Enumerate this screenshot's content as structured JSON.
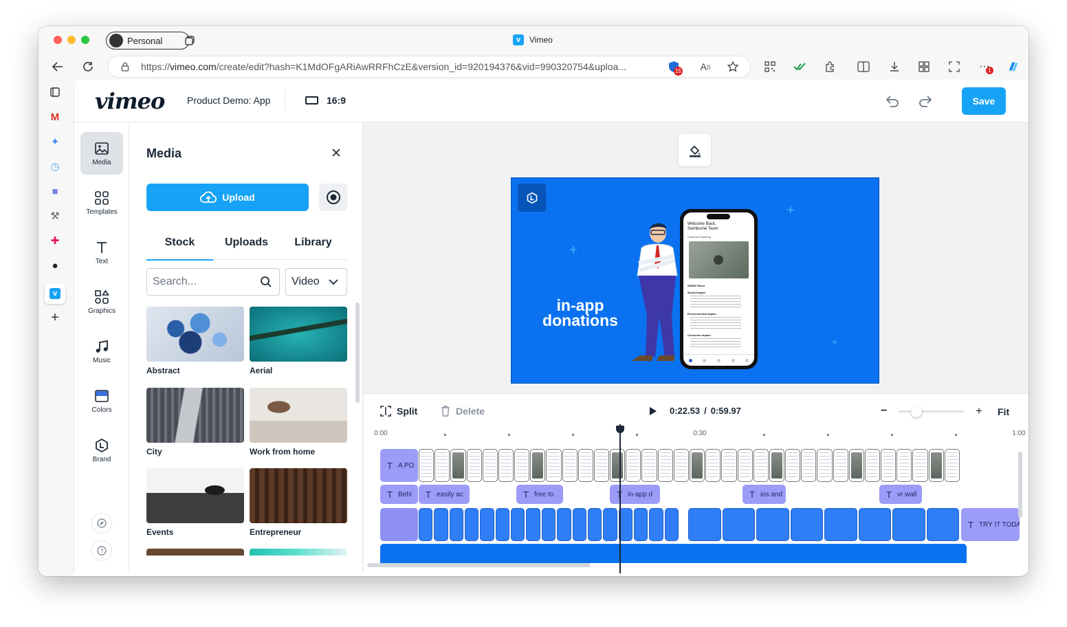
{
  "browser": {
    "tab_title": "Vimeo",
    "profile_label": "Personal",
    "url_base": "https://",
    "url_host": "vimeo.com",
    "url_path": "/create/edit?hash=K1MdOFgARiAwRRFhCzE&version_id=920194376&vid=990320754&uploa...",
    "extension_badge": "15",
    "more_badge": "1"
  },
  "editor": {
    "logo": "vimeo",
    "project_name": "Product Demo: App",
    "aspect_ratio": "16:9",
    "save_label": "Save"
  },
  "toolbar": [
    {
      "label": "Media",
      "icon": "image-icon",
      "active": true
    },
    {
      "label": "Templates",
      "icon": "templates-icon",
      "active": false
    },
    {
      "label": "Text",
      "icon": "text-icon",
      "active": false
    },
    {
      "label": "Graphics",
      "icon": "graphics-icon",
      "active": false
    },
    {
      "label": "Music",
      "icon": "music-icon",
      "active": false
    },
    {
      "label": "Colors",
      "icon": "colors-icon",
      "active": false
    },
    {
      "label": "Brand",
      "icon": "brand-icon",
      "active": false
    }
  ],
  "media_panel": {
    "title": "Media",
    "upload_label": "Upload",
    "tabs": [
      "Stock",
      "Uploads",
      "Library"
    ],
    "active_tab": "Stock",
    "search_placeholder": "Search...",
    "filter_value": "Video",
    "categories": [
      "Abstract",
      "Aerial",
      "City",
      "Work from home",
      "Events",
      "Entrepreneur"
    ]
  },
  "preview": {
    "headline_line1": "in-app",
    "headline_line2": "donations",
    "phone_greeting": "Welcome Back, Swinburne Team",
    "phone_subtitle": "Continue Exploring",
    "phone_section_title": "SHEIN Factor",
    "phone_headings": [
      "Social Impact",
      "Environmental Impact",
      "Consumer Impact"
    ]
  },
  "timeline": {
    "split_label": "Split",
    "delete_label": "Delete",
    "current_time": "0:22.53",
    "separator": "/",
    "total_time": "0:59.97",
    "fit_label": "Fit",
    "zoom_level": 0.25,
    "ruler_labels": [
      "0:00",
      "0:30",
      "1:00"
    ],
    "text_clips_row1": [
      "A PO"
    ],
    "text_clips_row2": [
      "Behi",
      "easily ac",
      "free to",
      "in-app d",
      "ios and",
      "vr wall"
    ],
    "end_text_clip": "TRY IT TODA"
  },
  "colors": {
    "accent": "#17a3f5",
    "preview_bg": "#0a72f0",
    "text_clip": "#9b9cf8",
    "audio_clip": "#0a72f0"
  }
}
